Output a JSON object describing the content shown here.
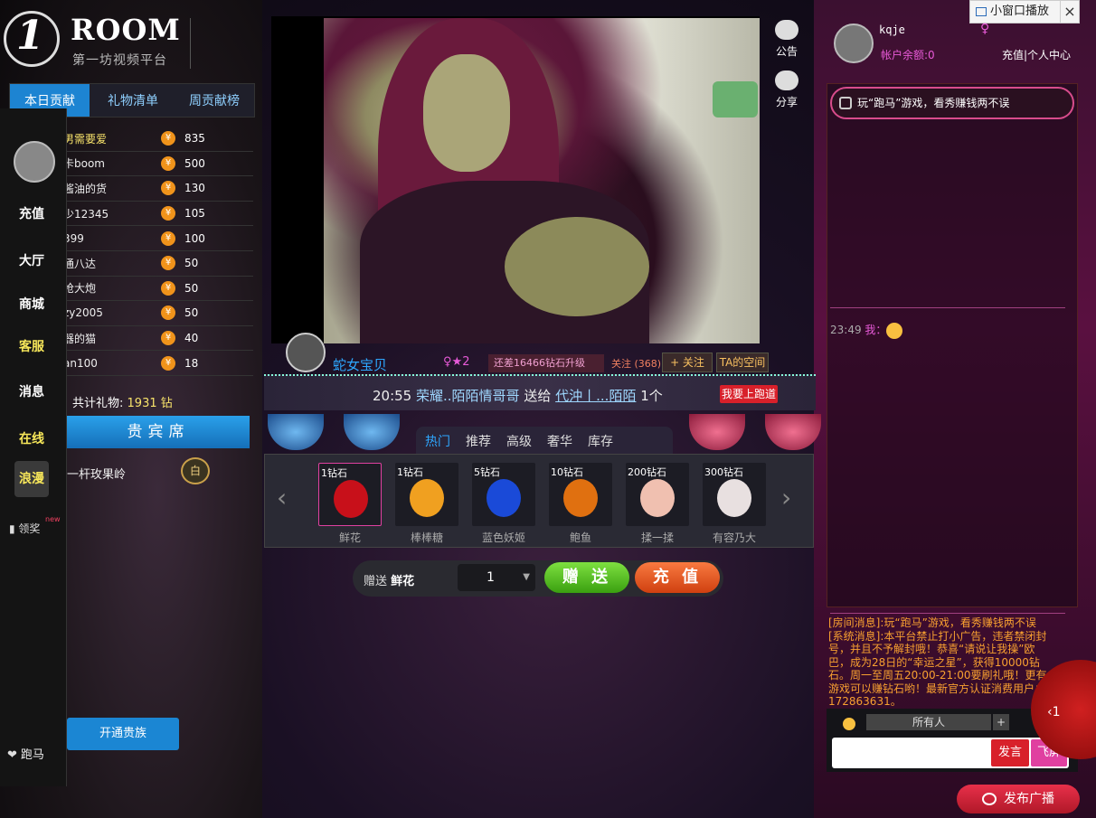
{
  "logo": {
    "mark": "1",
    "title": "ROOM",
    "subtitle": "第一坊视频平台"
  },
  "rank_tabs": [
    "本日贡献",
    "礼物清单",
    "周贡献榜"
  ],
  "rank_list": [
    {
      "name": "男需要爱",
      "value": "835"
    },
    {
      "name": "卡boom",
      "value": "500"
    },
    {
      "name": "酱油的货",
      "value": "130"
    },
    {
      "name": "少12345",
      "value": "105"
    },
    {
      "name": "399",
      "value": "100"
    },
    {
      "name": "通八达",
      "value": "50"
    },
    {
      "name": "枪大炮",
      "value": "50"
    },
    {
      "name": "zy2005",
      "value": "50"
    },
    {
      "name": "器的猫",
      "value": "40"
    },
    {
      "name": "an100",
      "value": "18"
    }
  ],
  "coin_glyph": "¥",
  "total_gift": {
    "label": "共计礼物:",
    "value": "1931",
    "unit": "钻"
  },
  "vip": {
    "title": "贵宾席",
    "member": "一杆玫果岭",
    "badge": "白",
    "open_btn": "开通贵族"
  },
  "sidebar": {
    "items": [
      "充值",
      "大厅",
      "商城",
      "客服",
      "消息",
      "在线",
      "浪漫"
    ],
    "lingjiang": "领奖",
    "new_tag": "new",
    "paoma": "跑马",
    "heart": "❤"
  },
  "video_side": {
    "notice": "公告",
    "share": "分享"
  },
  "host": {
    "name": "蛇女宝贝",
    "sex": "♀",
    "level": "2",
    "upgrade": "还差16466钻石升级",
    "fans": "关注 (368)",
    "follow_btn": "+ 关注",
    "space_btn": "TA的空间"
  },
  "marquee": {
    "time": "20:55",
    "from": "荣耀..陌陌情哥哥",
    "action": "送给",
    "to": "代沖丨...陌陌",
    "qty": "1个",
    "runway_btn": "我要上跑道"
  },
  "gift_tabs": [
    "热门",
    "推荐",
    "高级",
    "奢华",
    "库存"
  ],
  "gifts": [
    {
      "price": "1钻石",
      "name": "鲜花",
      "color": "#c8101a"
    },
    {
      "price": "1钻石",
      "name": "棒棒糖",
      "color": "#f0a020"
    },
    {
      "price": "5钻石",
      "name": "蓝色妖姬",
      "color": "#1a4ad8"
    },
    {
      "price": "10钻石",
      "name": "鲍鱼",
      "color": "#e07010"
    },
    {
      "price": "200钻石",
      "name": "揉一揉",
      "color": "#f0c0b0"
    },
    {
      "price": "300钻石",
      "name": "有容乃大",
      "color": "#e8e0e0"
    }
  ],
  "send": {
    "label": "赠送",
    "gift": "鲜花",
    "qty": "1",
    "send_btn": "赠 送",
    "recharge_btn": "充 值"
  },
  "user": {
    "name": "kqje",
    "sex": "♀",
    "balance": "帐户余额:0",
    "links": "充值|个人中心"
  },
  "mini_window": {
    "label": "小窗口播放",
    "close": "×"
  },
  "chat": {
    "notice": "玩“跑马”游戏，看秀赚钱两不误",
    "msg_time": "23:49",
    "msg_user": "我：",
    "sys_text": "[房间消息]:玩“跑马”游戏，看秀赚钱两不误[系统消息]:本平台禁止打小广告，违者禁闭封号，并且不予解封哦！恭喜“请说让我操”欧巴，成为28日的“幸运之星”，获得10000钻石。周一至周五20:00-21:00要刷礼哦！更有游戏可以赚钻石哟！最新官方认证消费用户：172863631。",
    "target": "所有人",
    "target_plus": "+",
    "say_btn": "发言",
    "fly_btn": "飞屏",
    "circle_label": "‹1",
    "broadcast_btn": "发布广播"
  },
  "colors": {
    "accent_blue": "#1d84d2",
    "accent_pink": "#e85ad8",
    "gold": "#f8e36b"
  }
}
